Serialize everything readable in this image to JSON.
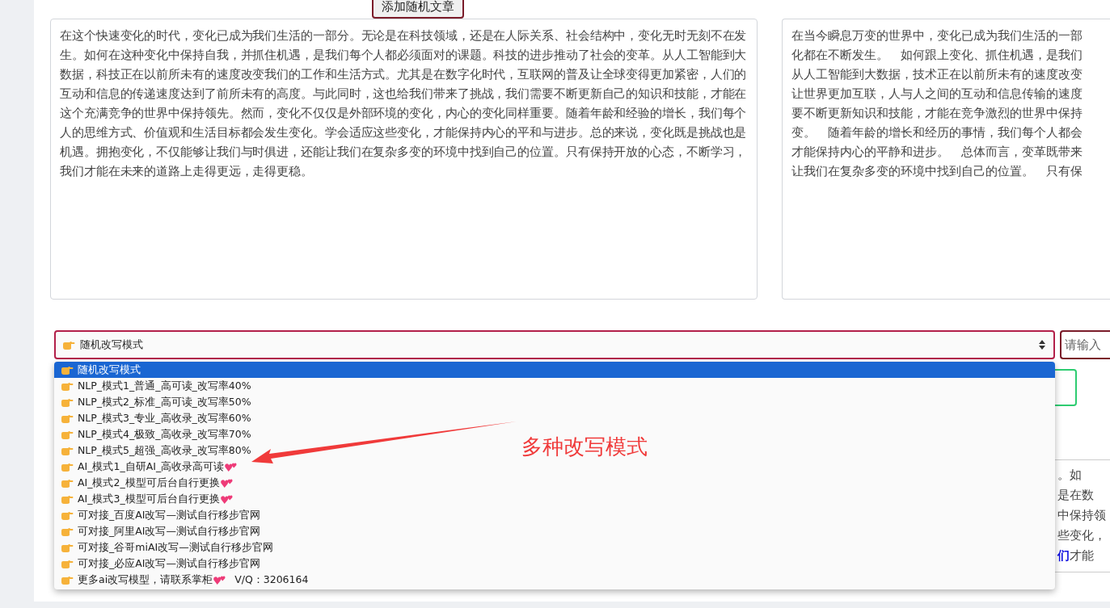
{
  "random_article_button": "添加随机文章",
  "source_text": "在这个快速变化的时代，变化已成为我们生活的一部分。无论是在科技领域，还是在人际关系、社会结构中，变化无时无刻不在发生。如何在这种变化中保持自我，并抓住机遇，是我们每个人都必须面对的课题。科技的进步推动了社会的变革。从人工智能到大数据，科技正在以前所未有的速度改变我们的工作和生活方式。尤其是在数字化时代，互联网的普及让全球变得更加紧密，人们的互动和信息的传递速度达到了前所未有的高度。与此同时，这也给我们带来了挑战，我们需要不断更新自己的知识和技能，才能在这个充满竞争的世界中保持领先。然而，变化不仅仅是外部环境的变化，内心的变化同样重要。随着年龄和经验的增长，我们每个人的思维方式、价值观和生活目标都会发生变化。学会适应这些变化，才能保持内心的平和与进步。总的来说，变化既是挑战也是机遇。拥抱变化，不仅能够让我们与时俱进，还能让我们在复杂多变的环境中找到自己的位置。只有保持开放的心态，不断学习，我们才能在未来的道路上走得更远，走得更稳。",
  "rewritten_lines": [
    "在当今瞬息万变的世界中，变化已成为我们生活的一部",
    "化都在不断发生。　如何跟上变化、抓住机遇，是我们",
    "从人工智能到大数据，技术正在以前所未有的速度改变",
    "让世界更加互联，人与人之间的互动和信息传输的速度",
    "要不断更新知识和技能，才能在竞争激烈的世界中保持",
    "变。　随着年龄的增长和经历的事情，我们每个人都会",
    "才能保持内心的平静和进步。　总体而言，变革既带来",
    "让我们在复杂多变的环境中找到自己的位置。　只有保"
  ],
  "mode_select": {
    "value": "随机改写模式",
    "expanded": true
  },
  "test_input": {
    "placeholder": "请输入"
  },
  "mode_options": [
    {
      "label": "随机改写模式",
      "heart": false,
      "selected": true
    },
    {
      "label": "NLP_模式1_普通_高可读_改写率40%",
      "heart": false,
      "selected": false
    },
    {
      "label": "NLP_模式2_标准_高可读_改写率50%",
      "heart": false,
      "selected": false
    },
    {
      "label": "NLP_模式3_专业_高收录_改写率60%",
      "heart": false,
      "selected": false
    },
    {
      "label": "NLP_模式4_极致_高收录_改写率70%",
      "heart": false,
      "selected": false
    },
    {
      "label": "NLP_模式5_超强_高收录_改写率80%",
      "heart": false,
      "selected": false
    },
    {
      "label": "AI_模式1_自研AI_高收录高可读",
      "heart": true,
      "selected": false
    },
    {
      "label": "AI_模式2_模型可后台自行更换",
      "heart": true,
      "selected": false
    },
    {
      "label": "AI_模式3_模型可后台自行更换",
      "heart": true,
      "selected": false
    },
    {
      "label": "可对接_百度AI改写—测试自行移步官网",
      "heart": false,
      "selected": false
    },
    {
      "label": "可对接_阿里AI改写—测试自行移步官网",
      "heart": false,
      "selected": false
    },
    {
      "label": "可对接_谷哥miAI改写—测试自行移步官网",
      "heart": false,
      "selected": false
    },
    {
      "label": "可对接_必应AI改写—测试自行移步官网",
      "heart": false,
      "selected": false
    },
    {
      "label": "更多ai改写模型，请联系掌柜",
      "heart": true,
      "extra": "V/Q：3206164",
      "selected": false
    }
  ],
  "result_lines": [
    {
      "text": "。",
      "after": "如"
    },
    {
      "text": "是在数"
    },
    {
      "text": "中保持领"
    },
    {
      "text": "些变化，"
    },
    {
      "text": "们",
      "link": true,
      "after": "才能"
    }
  ],
  "annotation": "多种改写模式"
}
